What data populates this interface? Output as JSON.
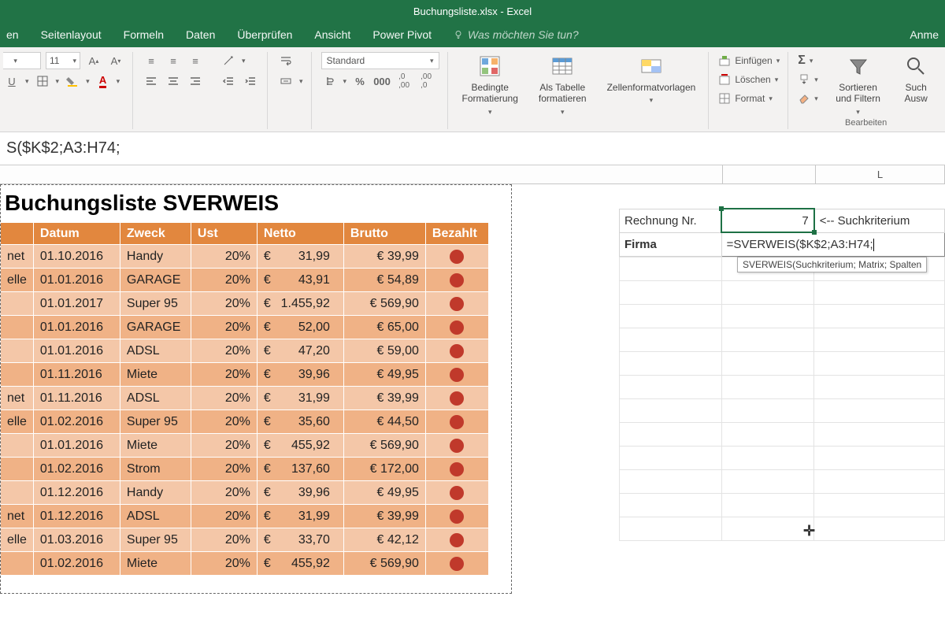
{
  "title": "Buchungsliste.xlsx - Excel",
  "tabs": [
    "en",
    "Seitenlayout",
    "Formeln",
    "Daten",
    "Überprüfen",
    "Ansicht",
    "Power Pivot"
  ],
  "tellme": "Was möchten Sie tun?",
  "account": "Anme",
  "ribbon": {
    "fontsize": "11",
    "numfmt": "Standard",
    "cond_fmt": "Bedingte Formatierung",
    "as_table": "Als Tabelle formatieren",
    "cell_styles": "Zellenformatvorlagen",
    "insert": "Einfügen",
    "delete": "Löschen",
    "format": "Format",
    "sort_filter": "Sortieren und Filtern",
    "find_select": "Such Ausw",
    "group_edit": "Bearbeiten"
  },
  "formula_bar": "S($K$2;A3:H74;",
  "col_L": "L",
  "sheet_title": "Buchungsliste SVERWEIS",
  "headers": [
    "",
    "Datum",
    "Zweck",
    "Ust",
    "Netto",
    "Brutto",
    "Bezahlt"
  ],
  "rows": [
    {
      "c0": "net",
      "datum": "01.10.2016",
      "zweck": "Handy",
      "ust": "20%",
      "netto": "31,99",
      "brutto": "€ 39,99"
    },
    {
      "c0": "elle",
      "datum": "01.01.2016",
      "zweck": "GARAGE",
      "ust": "20%",
      "netto": "43,91",
      "brutto": "€ 54,89"
    },
    {
      "c0": "",
      "datum": "01.01.2017",
      "zweck": "Super 95",
      "ust": "20%",
      "netto": "1.455,92",
      "brutto": "€ 569,90"
    },
    {
      "c0": "",
      "datum": "01.01.2016",
      "zweck": "GARAGE",
      "ust": "20%",
      "netto": "52,00",
      "brutto": "€ 65,00"
    },
    {
      "c0": "",
      "datum": "01.01.2016",
      "zweck": "ADSL",
      "ust": "20%",
      "netto": "47,20",
      "brutto": "€ 59,00"
    },
    {
      "c0": "",
      "datum": "01.11.2016",
      "zweck": "Miete",
      "ust": "20%",
      "netto": "39,96",
      "brutto": "€ 49,95"
    },
    {
      "c0": "net",
      "datum": "01.11.2016",
      "zweck": "ADSL",
      "ust": "20%",
      "netto": "31,99",
      "brutto": "€ 39,99"
    },
    {
      "c0": "elle",
      "datum": "01.02.2016",
      "zweck": "Super 95",
      "ust": "20%",
      "netto": "35,60",
      "brutto": "€ 44,50"
    },
    {
      "c0": "",
      "datum": "01.01.2016",
      "zweck": "Miete",
      "ust": "20%",
      "netto": "455,92",
      "brutto": "€ 569,90"
    },
    {
      "c0": "",
      "datum": "01.02.2016",
      "zweck": "Strom",
      "ust": "20%",
      "netto": "137,60",
      "brutto": "€ 172,00"
    },
    {
      "c0": "",
      "datum": "01.12.2016",
      "zweck": "Handy",
      "ust": "20%",
      "netto": "39,96",
      "brutto": "€ 49,95"
    },
    {
      "c0": "net",
      "datum": "01.12.2016",
      "zweck": "ADSL",
      "ust": "20%",
      "netto": "31,99",
      "brutto": "€ 39,99"
    },
    {
      "c0": "elle",
      "datum": "01.03.2016",
      "zweck": "Super 95",
      "ust": "20%",
      "netto": "33,70",
      "brutto": "€ 42,12"
    },
    {
      "c0": "",
      "datum": "01.02.2016",
      "zweck": "Miete",
      "ust": "20%",
      "netto": "455,92",
      "brutto": "€ 569,90"
    }
  ],
  "lookup": {
    "rechnung_lbl": "Rechnung Nr.",
    "rechnung_val": "7",
    "suchkrit": "<-- Suchkriterium",
    "firma_lbl": "Firma",
    "formula": "=SVERWEIS($K$2;A3:H74;",
    "tooltip": "SVERWEIS(Suchkriterium; Matrix; Spalten"
  }
}
